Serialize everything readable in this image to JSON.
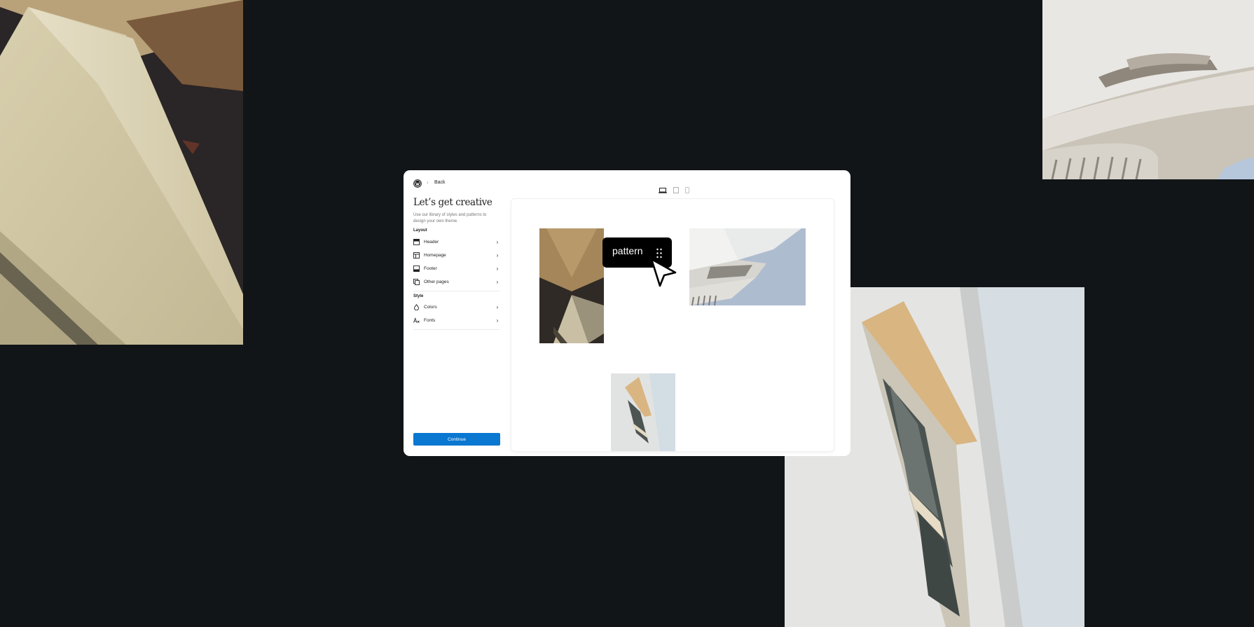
{
  "header": {
    "back_label": "Back",
    "separator": "›"
  },
  "sidebar": {
    "title": "Let’s get creative",
    "description": "Use our library of styles and patterns to design your own theme.",
    "layout_label": "Layout",
    "layout_items": [
      {
        "label": "Header",
        "icon": "header-icon"
      },
      {
        "label": "Homepage",
        "icon": "homepage-icon"
      },
      {
        "label": "Footer",
        "icon": "footer-icon"
      },
      {
        "label": "Other pages",
        "icon": "pages-icon"
      }
    ],
    "style_label": "Style",
    "style_items": [
      {
        "label": "Colors",
        "icon": "droplet-icon"
      },
      {
        "label": "Fonts",
        "icon": "typography-icon"
      }
    ],
    "continue_label": "Continue",
    "chevron": "›"
  },
  "canvas": {
    "pattern_label": "pattern"
  },
  "colors": {
    "background": "#111518",
    "accent": "#0a77d1"
  }
}
